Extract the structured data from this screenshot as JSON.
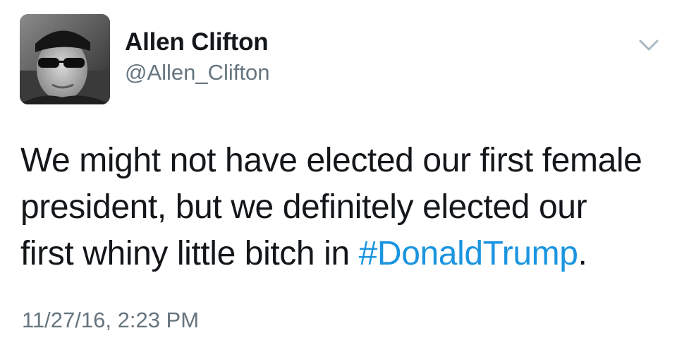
{
  "author": {
    "display_name": "Allen Clifton",
    "handle": "@Allen_Clifton",
    "avatar_icon": "profile-photo"
  },
  "menu": {
    "icon": "chevron-down-icon"
  },
  "tweet": {
    "text_line_1": "We might not have elected our first female",
    "text_line_2": "president, but we definitely elected our",
    "text_line_3": "first whiny little bitch in ",
    "hashtag": "#DonaldTrump",
    "text_end": ".",
    "timestamp": "11/27/16, 2:23 PM"
  },
  "colors": {
    "text": "#14171a",
    "secondary": "#66757f",
    "link": "#1b95e0",
    "background": "#ffffff"
  }
}
